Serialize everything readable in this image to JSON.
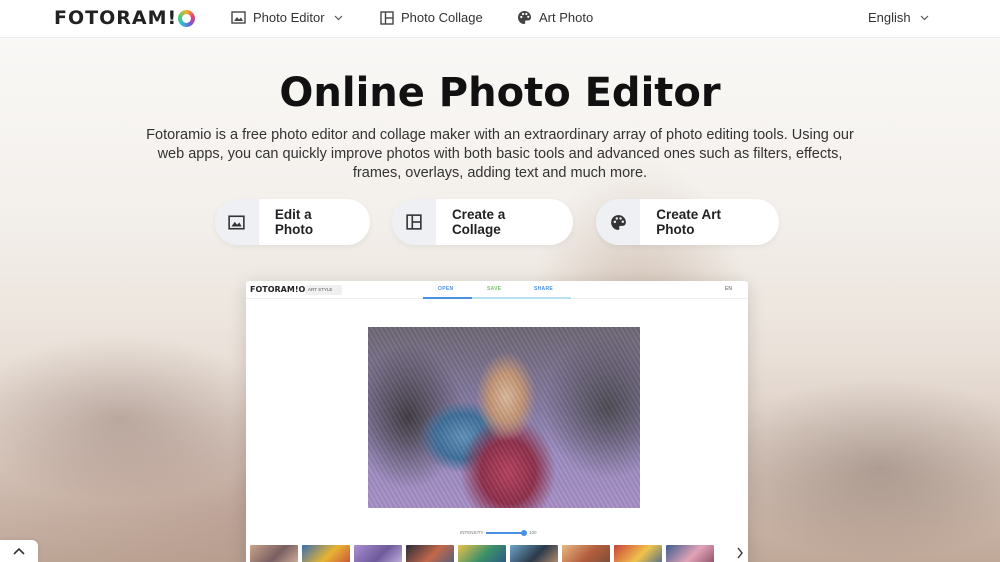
{
  "header": {
    "logo": "FOTORAM!",
    "nav": [
      {
        "label": "Photo Editor",
        "icon": "image-icon",
        "has_dropdown": true
      },
      {
        "label": "Photo Collage",
        "icon": "collage-icon",
        "has_dropdown": false
      },
      {
        "label": "Art Photo",
        "icon": "palette-icon",
        "has_dropdown": false
      }
    ],
    "language": "English"
  },
  "hero": {
    "title": "Online Photo Editor",
    "description": "Fotoramio is a free photo editor and collage maker with an extraordinary array of photo editing tools. Using our web apps, you can quickly improve photos with both basic tools and advanced ones such as filters, effects, frames, overlays, adding text and much more.",
    "actions": [
      {
        "label": "Edit a Photo",
        "icon": "image-icon"
      },
      {
        "label": "Create a Collage",
        "icon": "collage-icon"
      },
      {
        "label": "Create Art Photo",
        "icon": "palette-icon"
      }
    ]
  },
  "preview": {
    "logo": "FOTORAM!O",
    "style_select": "ART STYLE",
    "tabs": {
      "open": "OPEN",
      "save": "SAVE",
      "share": "SHARE"
    },
    "lang": "EN",
    "intensity_label": "INTENSITY",
    "intensity_value": "100"
  },
  "colors": {
    "accent_blue": "#4a90e2",
    "accent_green": "#7cc46c",
    "button_cap": "#eef0f4"
  }
}
